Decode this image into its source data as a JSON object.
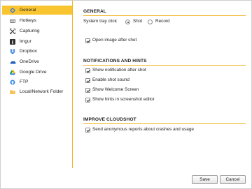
{
  "sidebar": {
    "items": [
      {
        "label": "General",
        "icon": "settings-icon",
        "active": true
      },
      {
        "label": "Hotkeys",
        "icon": "keyboard-icon",
        "active": false
      },
      {
        "label": "Capturing",
        "icon": "crop-icon",
        "active": false
      },
      {
        "label": "Imgur",
        "icon": "imgur-icon",
        "active": false
      },
      {
        "label": "Dropbox",
        "icon": "dropbox-icon",
        "active": false
      },
      {
        "label": "OneDrive",
        "icon": "onedrive-icon",
        "active": false
      },
      {
        "label": "Google Drive",
        "icon": "google-drive-icon",
        "active": false
      },
      {
        "label": "FTP",
        "icon": "ftp-icon",
        "active": false
      },
      {
        "label": "Local/Network Folder",
        "icon": "folder-icon",
        "active": false
      }
    ]
  },
  "general": {
    "title": "GENERAL",
    "tray_label": "System tray click",
    "tray_options": [
      {
        "label": "Shot",
        "selected": true
      },
      {
        "label": "Record",
        "selected": false
      }
    ],
    "open_after_shot": {
      "label": "Open image after shot",
      "checked": true
    }
  },
  "notifications": {
    "title": "NOTIFICATIONS AND HINTS",
    "options": [
      {
        "label": "Show notification after shot",
        "checked": true
      },
      {
        "label": "Enable shot sound",
        "checked": true
      },
      {
        "label": "Show Welcome Screen",
        "checked": true
      },
      {
        "label": "Show hints in screenshot editor",
        "checked": true
      }
    ]
  },
  "improve": {
    "title": "IMPROVE CLOUDSHOT",
    "options": [
      {
        "label": "Send anonymous reports about crashes and usage",
        "checked": true
      }
    ]
  },
  "footer": {
    "save_label": "Save",
    "cancel_label": "Cancel"
  },
  "colors": {
    "accent": "#f8c531",
    "rule": "#f0b320"
  }
}
